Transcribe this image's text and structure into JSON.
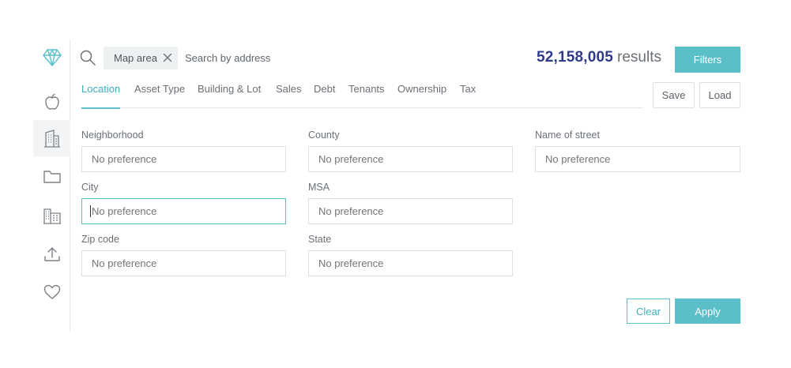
{
  "sidebar": {
    "items": [
      {
        "icon": "diamond-logo-icon"
      },
      {
        "icon": "apple-icon"
      },
      {
        "icon": "building-icon"
      },
      {
        "icon": "folder-icon"
      },
      {
        "icon": "buildings-icon"
      },
      {
        "icon": "upload-icon"
      },
      {
        "icon": "heart-icon"
      }
    ],
    "active_index": 2
  },
  "search": {
    "chip_label": "Map area",
    "placeholder": "Search by address"
  },
  "results": {
    "count": "52,158,005",
    "label": "results"
  },
  "toolbar": {
    "filters_label": "Filters",
    "save_label": "Save",
    "load_label": "Load"
  },
  "tabs": [
    {
      "label": "Location",
      "active": true
    },
    {
      "label": "Asset Type"
    },
    {
      "label": "Building & Lot"
    },
    {
      "label": "Sales"
    },
    {
      "label": "Debt"
    },
    {
      "label": "Tenants"
    },
    {
      "label": "Ownership"
    },
    {
      "label": "Tax"
    }
  ],
  "fields": {
    "neighborhood": {
      "label": "Neighborhood",
      "placeholder": "No preference"
    },
    "county": {
      "label": "County",
      "placeholder": "No preference"
    },
    "street": {
      "label": "Name of street",
      "placeholder": "No preference"
    },
    "city": {
      "label": "City",
      "placeholder": "No preference"
    },
    "msa": {
      "label": "MSA",
      "placeholder": "No preference"
    },
    "zip": {
      "label": "Zip code",
      "placeholder": "No preference"
    },
    "state": {
      "label": "State",
      "placeholder": "No preference"
    }
  },
  "actions": {
    "clear_label": "Clear",
    "apply_label": "Apply"
  },
  "colors": {
    "accent": "#5bbfc9",
    "results_count": "#2f3a8a"
  }
}
